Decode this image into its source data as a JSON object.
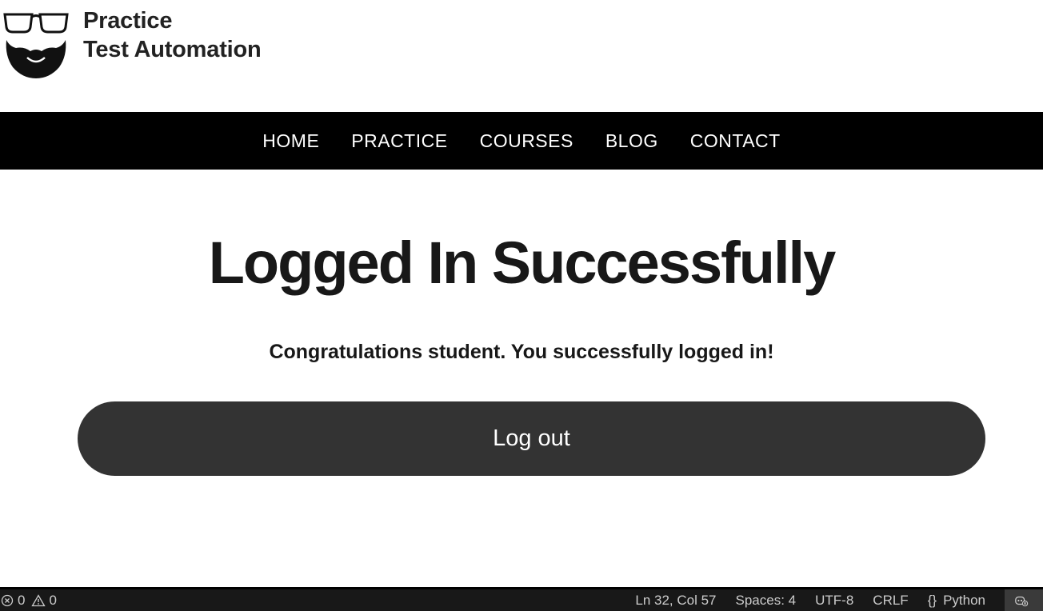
{
  "site": {
    "logo_line1": "Practice",
    "logo_line2": "Test Automation"
  },
  "nav": {
    "items": [
      {
        "label": "HOME"
      },
      {
        "label": "PRACTICE"
      },
      {
        "label": "COURSES"
      },
      {
        "label": "BLOG"
      },
      {
        "label": "CONTACT"
      }
    ]
  },
  "main": {
    "title": "Logged In Successfully",
    "message": "Congratulations student. You successfully logged in!",
    "logout_label": "Log out"
  },
  "statusbar": {
    "errors": "0",
    "warnings": "0",
    "position": "Ln 32, Col 57",
    "spaces": "Spaces: 4",
    "encoding": "UTF-8",
    "line_ending": "CRLF",
    "language": "Python"
  },
  "colors": {
    "nav_bg": "#000000",
    "button_bg": "#333333",
    "statusbar_bg": "#181818"
  },
  "icons": [
    "logo-glasses-beard-icon",
    "error-icon",
    "warning-icon",
    "braces-icon",
    "copilot-icon"
  ]
}
